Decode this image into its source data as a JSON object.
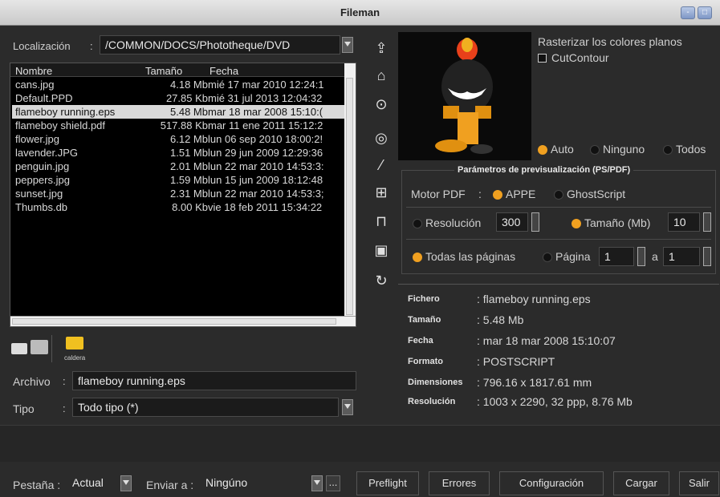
{
  "window": {
    "title": "Fileman"
  },
  "location": {
    "label": "Localización",
    "sep": ":",
    "value": "/COMMON/DOCS/Phototheque/DVD"
  },
  "files": {
    "headers": [
      "Nombre",
      "Tamaño",
      "Fecha"
    ],
    "rows": [
      {
        "name": "cans.jpg",
        "size": "4.18 Mb",
        "date": "mié 17 mar 2010 12:24:1"
      },
      {
        "name": "Default.PPD",
        "size": "27.85 Kb",
        "date": "mié 31 jul 2013 12:04:32"
      },
      {
        "name": "flameboy running.eps",
        "size": "5.48 Mb",
        "date": "mar 18 mar 2008 15:10:("
      },
      {
        "name": "flameboy shield.pdf",
        "size": "517.88 Kb",
        "date": "mar 11 ene 2011 15:12:2"
      },
      {
        "name": "flower.jpg",
        "size": "6.12 Mb",
        "date": "lun 06 sep 2010 18:00:2!"
      },
      {
        "name": "lavender.JPG",
        "size": "1.51 Mb",
        "date": "lun 29 jun 2009 12:29:36"
      },
      {
        "name": "penguin.jpg",
        "size": "2.01 Mb",
        "date": "lun 22 mar 2010 14:53:3:"
      },
      {
        "name": "peppers.jpg",
        "size": "1.59 Mb",
        "date": "lun 15 jun 2009 18:12:48"
      },
      {
        "name": "sunset.jpg",
        "size": "2.31 Mb",
        "date": "lun 22 mar 2010 14:53:3;"
      },
      {
        "name": "Thumbs.db",
        "size": "8.00 Kb",
        "date": "vie 18 feb 2011 15:34:22"
      }
    ],
    "selected_index": 2
  },
  "bookmarks": {
    "caldera_label": "caldera"
  },
  "archivo": {
    "label": "Archivo",
    "sep": ":",
    "value": "flameboy running.eps"
  },
  "tipo": {
    "label": "Tipo",
    "sep": ":",
    "value": "Todo tipo (*)"
  },
  "raster": {
    "title": "Rasterizar los colores planos",
    "cutcontour": "CutContour",
    "auto": "Auto",
    "ninguno": "Ninguno",
    "todos": "Todos"
  },
  "preview_params": {
    "title": "Parámetros de previsualización (PS/PDF)",
    "motor_label": "Motor PDF",
    "sep": ":",
    "appe": "APPE",
    "ghostscript": "GhostScript",
    "resolucion_label": "Resolución",
    "resolucion_value": "300",
    "tamano_label": "Tamaño (Mb)",
    "tamano_value": "10",
    "todas_label": "Todas las páginas",
    "pagina_label": "Página",
    "pagina_from": "1",
    "a_label": "a",
    "pagina_to": "1"
  },
  "info": {
    "fichero": {
      "k": "Fichero",
      "v": ": flameboy running.eps"
    },
    "tamano": {
      "k": "Tamaño",
      "v": ": 5.48 Mb"
    },
    "fecha": {
      "k": "Fecha",
      "v": ": mar 18 mar 2008 15:10:07"
    },
    "formato": {
      "k": "Formato",
      "v": ": POSTSCRIPT"
    },
    "dimensiones": {
      "k": "Dimensiones",
      "v": ": 796.16 x 1817.61 mm"
    },
    "resolucion": {
      "k": "Resolución",
      "v": ": 1003 x 2290, 32 ppp, 8.76 Mb"
    }
  },
  "bottom": {
    "pestana_label": "Pestaña :",
    "pestana_value": "Actual",
    "enviar_label": "Enviar a :",
    "enviar_value": "Ningúno",
    "more": "...",
    "preflight": "Preflight",
    "errores": "Errores",
    "configuracion": "Configuración",
    "cargar": "Cargar",
    "salir": "Salir"
  },
  "colors": {
    "accent": "#f0a020",
    "bg": "#2b2b2b",
    "list_bg": "#000000"
  }
}
